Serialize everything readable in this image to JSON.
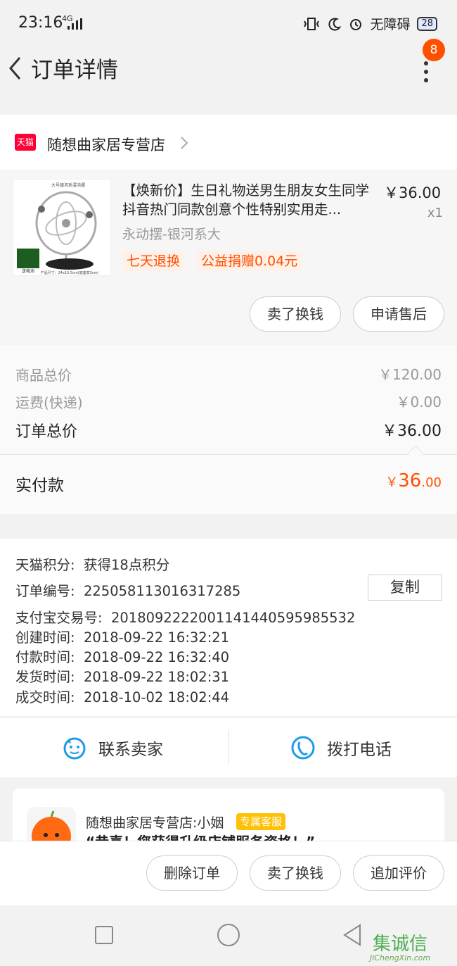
{
  "status_bar": {
    "time": "23:16",
    "network": "4G",
    "accessibility": "无障碍",
    "battery": "28"
  },
  "nav": {
    "title": "订单详情",
    "badge_count": "8"
  },
  "shop": {
    "logo_text": "天猫",
    "name": "随想曲家居专营店"
  },
  "product": {
    "title": "【焕新价】生日礼物送男生朋友女生同学抖音热门同款创意个性特别实用走...",
    "price": "￥36.00",
    "qty": "x1",
    "sku": "永动摆-银河系大",
    "tags": [
      "七天退换",
      "公益捐赠0.04元"
    ],
    "image_caption_top": "大号银河系混沌摆",
    "image_caption_bottom": "产品尺寸：24x10.5cm(底座高3cm)",
    "image_battery_label": "送电池",
    "buttons": [
      "卖了换钱",
      "申请售后"
    ]
  },
  "totals": {
    "goods_label": "商品总价",
    "goods_value": "￥120.00",
    "shipping_label": "运费(快递)",
    "shipping_value": "￥0.00",
    "order_label": "订单总价",
    "order_value": "￥36.00",
    "paid_label": "实付款",
    "paid_symbol": "￥",
    "paid_int": "36",
    "paid_dec": ".00"
  },
  "info": {
    "points_label": "天猫积分:",
    "points_value": "获得18点积分",
    "order_no_label": "订单编号:",
    "order_no_value": "225058113016317285",
    "copy_label": "复制",
    "alipay_label": "支付宝交易号:",
    "alipay_value": "2018092222001141440595985532",
    "created_label": "创建时间:",
    "created_value": "2018-09-22 16:32:21",
    "paid_time_label": "付款时间:",
    "paid_time_value": "2018-09-22 16:32:40",
    "shipped_label": "发货时间:",
    "shipped_value": "2018-09-22 18:02:31",
    "completed_label": "成交时间:",
    "completed_value": "2018-10-02 18:02:44"
  },
  "contact": {
    "seller": "联系卖家",
    "phone": "拨打电话"
  },
  "service": {
    "name": "随想曲家居专营店:小姻",
    "badge": "专属客服",
    "message": "“恭喜！您获得升级店铺服务资格！”"
  },
  "bottom_actions": [
    "删除订单",
    "卖了换钱",
    "追加评价"
  ],
  "watermark": {
    "text": "集诚信",
    "sub": "JiChengXin.com"
  },
  "colors": {
    "accent": "#ff5000",
    "blue_icon": "#1e9be8",
    "tmall_red": "#ff0036"
  }
}
